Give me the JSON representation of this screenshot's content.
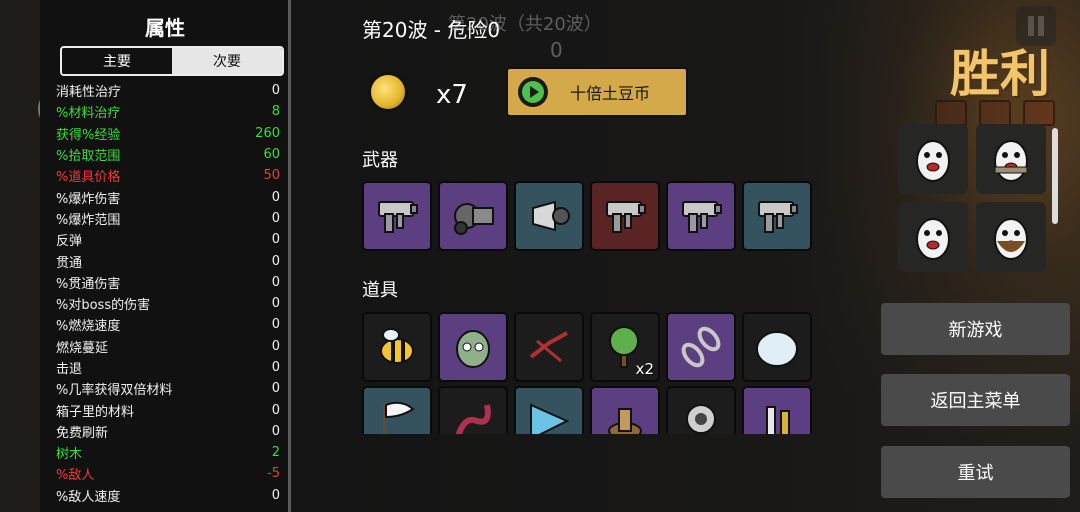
{
  "stats_panel": {
    "title": "属性",
    "tabs": [
      {
        "label": "主要",
        "active": true
      },
      {
        "label": "次要",
        "active": false
      }
    ],
    "rows": [
      {
        "label": "消耗性治疗",
        "value": "0",
        "color": "white"
      },
      {
        "label": "%材料治疗",
        "value": "8",
        "color": "green"
      },
      {
        "label": "获得%经验",
        "value": "260",
        "color": "green"
      },
      {
        "label": "%拾取范围",
        "value": "60",
        "color": "green"
      },
      {
        "label": "%道具价格",
        "value": "50",
        "color": "red"
      },
      {
        "label": "%爆炸伤害",
        "value": "0",
        "color": "white"
      },
      {
        "label": "%爆炸范围",
        "value": "0",
        "color": "white"
      },
      {
        "label": "反弹",
        "value": "0",
        "color": "white"
      },
      {
        "label": "贯通",
        "value": "0",
        "color": "white"
      },
      {
        "label": "%贯通伤害",
        "value": "0",
        "color": "white"
      },
      {
        "label": "%对boss的伤害",
        "value": "0",
        "color": "white"
      },
      {
        "label": "%燃烧速度",
        "value": "0",
        "color": "white"
      },
      {
        "label": "燃烧蔓延",
        "value": "0",
        "color": "white"
      },
      {
        "label": "击退",
        "value": "0",
        "color": "white"
      },
      {
        "label": "%几率获得双倍材料",
        "value": "0",
        "color": "white"
      },
      {
        "label": "箱子里的材料",
        "value": "0",
        "color": "white"
      },
      {
        "label": "免费刷新",
        "value": "0",
        "color": "white"
      },
      {
        "label": "树木",
        "value": "2",
        "color": "green"
      },
      {
        "label": "%敌人",
        "value": "-5",
        "color": "red"
      },
      {
        "label": "%敌人速度",
        "value": "0",
        "color": "white"
      }
    ]
  },
  "header": {
    "wave_label": "第20波 - 危险0",
    "background_wave": "第20波（共20波）",
    "background_counter": "0"
  },
  "reward": {
    "coin_icon": "potato-coin-icon",
    "count": "x7",
    "button_label": "十倍土豆币",
    "button_icon": "play-icon"
  },
  "weapons": {
    "heading": "武器",
    "items": [
      {
        "icon": "smg-icon",
        "bg": "purple"
      },
      {
        "icon": "minigun-icon",
        "bg": "purple"
      },
      {
        "icon": "shredder-icon",
        "bg": "teal"
      },
      {
        "icon": "smg-icon",
        "bg": "darkred"
      },
      {
        "icon": "smg-icon",
        "bg": "purple"
      },
      {
        "icon": "smg-icon",
        "bg": "teal"
      }
    ]
  },
  "items": {
    "heading": "道具",
    "row1": [
      {
        "icon": "bee-icon",
        "bg": "black",
        "count": ""
      },
      {
        "icon": "zombie-head-icon",
        "bg": "purple",
        "count": ""
      },
      {
        "icon": "barbed-wire-icon",
        "bg": "black",
        "count": ""
      },
      {
        "icon": "tree-icon",
        "bg": "black",
        "count": "x2"
      },
      {
        "icon": "chain-link-icon",
        "bg": "purple",
        "count": ""
      },
      {
        "icon": "snowball-icon",
        "bg": "black",
        "count": ""
      }
    ],
    "row2": [
      {
        "icon": "white-flag-icon",
        "bg": "teal"
      },
      {
        "icon": "tentacle-icon",
        "bg": "black"
      },
      {
        "icon": "crystal-icon",
        "bg": "teal"
      },
      {
        "icon": "stump-icon",
        "bg": "purple"
      },
      {
        "icon": "robot-icon",
        "bg": "black"
      },
      {
        "icon": "statue-icon",
        "bg": "purple"
      }
    ]
  },
  "result": {
    "title": "胜利"
  },
  "characters": [
    {
      "icon": "potato-scream-icon"
    },
    {
      "icon": "potato-scarf-icon"
    },
    {
      "icon": "potato-happy-icon"
    },
    {
      "icon": "potato-bearded-icon"
    }
  ],
  "actions": {
    "new_game": "新游戏",
    "main_menu": "返回主菜单",
    "retry": "重试"
  },
  "colors": {
    "gold_button": "#d3a94a",
    "victory_text": "#f1c56a",
    "green_stat": "#3ddc3d",
    "red_stat": "#f03a3a",
    "purple_slot": "#5c3f80",
    "teal_slot": "#35525f",
    "action_button": "#4a4a4a"
  }
}
